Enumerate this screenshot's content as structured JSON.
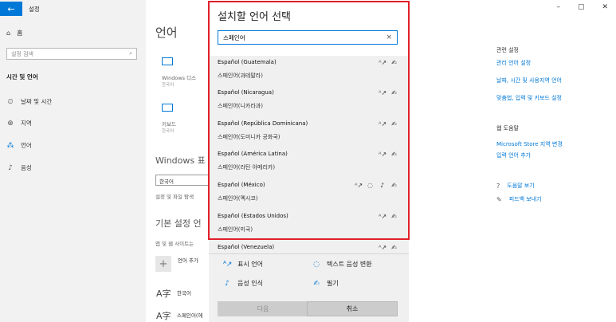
{
  "app": {
    "title": "설정",
    "back_glyph": "←"
  },
  "window_controls": {
    "minimize": "–",
    "maximize": "▢",
    "close": "✕"
  },
  "sidebar": {
    "home": {
      "icon": "⌂",
      "label": "홈"
    },
    "search_placeholder": "설정 검색",
    "search_icon": "⌕",
    "section": "시간 및 언어",
    "items": [
      {
        "icon": "⏲",
        "label": "날짜 및 시간"
      },
      {
        "icon": "⊕",
        "label": "지역"
      },
      {
        "icon": "⁂",
        "label": "언어"
      },
      {
        "icon": "♪",
        "label": "음성"
      }
    ]
  },
  "main": {
    "title": "언어",
    "tiles": [
      {
        "label": "Windows 디스",
        "sub": "한국어"
      },
      {
        "label": "키보드",
        "sub": "한국어"
      }
    ],
    "windows_display_heading": "Windows 표",
    "display_lang_value": "한국어",
    "settings_note": "설정 및 파일 탐색",
    "preferred_heading": "기본 설정 언",
    "apps_note": "앱 및 웹 사이트는",
    "add_lang": "언어 추가",
    "langs": [
      {
        "glyph": "A字",
        "name": "한국어"
      },
      {
        "glyph": "A字",
        "name": "스페인어(에"
      }
    ]
  },
  "right": {
    "related_heading": "관련 설정",
    "related_links": [
      "관리 언어 설정",
      "날짜, 시간 및 사용지역 언어",
      "맞춤법, 입력 및 키보드 설정"
    ],
    "web_help_heading": "웹 도움말",
    "web_help_links": [
      "Microsoft Store 지역 변경",
      "입력 언어 추가"
    ],
    "help_items": [
      {
        "icon": "?",
        "label": "도움말 보기"
      },
      {
        "icon": "✎",
        "label": "피드백 보내기"
      }
    ]
  },
  "dialog": {
    "title": "설치할 언어 선택",
    "search_value": "스페인어",
    "clear_icon": "×",
    "languages": [
      {
        "name": "Español (Guatemala)",
        "local": "스페인어(과테말라)",
        "features": [
          "display",
          "handwriting"
        ]
      },
      {
        "name": "Español (Nicaragua)",
        "local": "스페인어(니카라과)",
        "features": [
          "display",
          "handwriting"
        ]
      },
      {
        "name": "Español (República Dominicana)",
        "local": "스페인어(도미니카 공화국)",
        "features": [
          "display",
          "handwriting"
        ]
      },
      {
        "name": "Español (América Latina)",
        "local": "스페인어(라틴 아메리카)",
        "features": [
          "display",
          "handwriting"
        ]
      },
      {
        "name": "Español (México)",
        "local": "스페인어(멕시코)",
        "features": [
          "display",
          "tts",
          "speech",
          "handwriting"
        ]
      },
      {
        "name": "Español (Estados Unidos)",
        "local": "스페인어(미국)",
        "features": [
          "display",
          "handwriting"
        ]
      },
      {
        "name": "Español (Venezuela)",
        "local": "",
        "features": [
          "display",
          "handwriting"
        ]
      }
    ],
    "feature_icons": {
      "display": "ᴬ↗",
      "tts": "◌",
      "speech": "♪",
      "handwriting": "✍"
    },
    "legend": [
      {
        "icon": "ᴬ↗",
        "label": "표시 언어"
      },
      {
        "icon": "◌",
        "label": "텍스트 음성 변환"
      },
      {
        "icon": "♪",
        "label": "음성 인식"
      },
      {
        "icon": "✍",
        "label": "필기"
      }
    ],
    "next_label": "다음",
    "cancel_label": "취소"
  },
  "colors": {
    "accent": "#0078d7",
    "highlight": "#e0202a"
  }
}
